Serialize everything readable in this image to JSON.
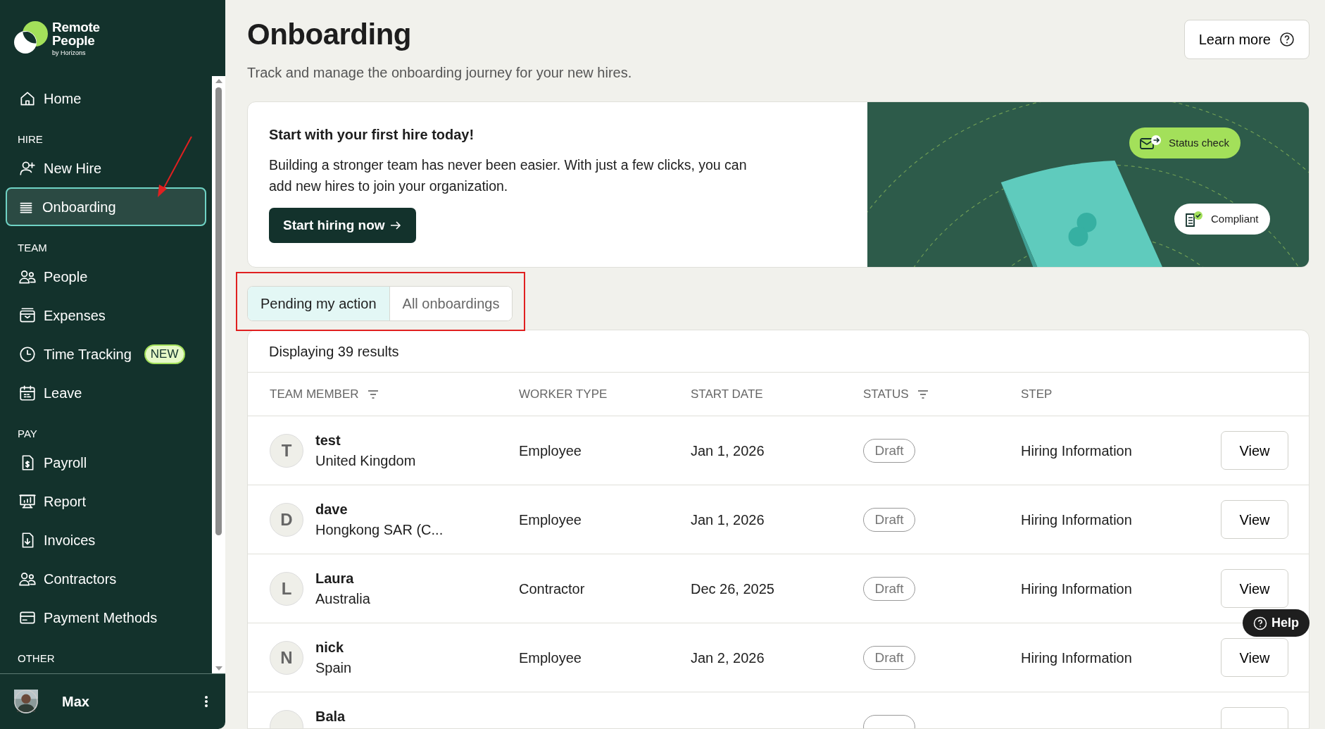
{
  "sidebar": {
    "logo": {
      "line1": "Remote",
      "line2": "People",
      "tagline": "by Horizons"
    },
    "sections": [
      {
        "items": [
          {
            "label": "Home",
            "selected": false
          }
        ]
      },
      {
        "heading": "HIRE",
        "items": [
          {
            "label": "New Hire",
            "selected": false
          },
          {
            "label": "Onboarding",
            "selected": true
          }
        ]
      },
      {
        "heading": "TEAM",
        "items": [
          {
            "label": "People",
            "selected": false
          },
          {
            "label": "Expenses",
            "selected": false
          },
          {
            "label": "Time Tracking",
            "selected": false,
            "badge": "NEW"
          },
          {
            "label": "Leave",
            "selected": false
          }
        ]
      },
      {
        "heading": "PAY",
        "items": [
          {
            "label": "Payroll",
            "selected": false
          },
          {
            "label": "Report",
            "selected": false
          },
          {
            "label": "Invoices",
            "selected": false
          },
          {
            "label": "Contractors",
            "selected": false
          },
          {
            "label": "Payment Methods",
            "selected": false
          }
        ]
      },
      {
        "heading": "OTHER"
      }
    ],
    "user": {
      "name": "Max"
    }
  },
  "header": {
    "title": "Onboarding",
    "subtitle": "Track and manage the onboarding journey for your new hires.",
    "learn_more": "Learn more"
  },
  "banner": {
    "title": "Start with your first hire today!",
    "text": "Building a stronger team has never been easier. With just a few clicks, you can add new hires to join your organization.",
    "button": "Start hiring now",
    "pills": [
      {
        "label": "Status check",
        "kind": "status"
      },
      {
        "label": "Compliant",
        "kind": "compliant"
      }
    ]
  },
  "tabs": [
    {
      "label": "Pending my action",
      "selected": true
    },
    {
      "label": "All onboardings",
      "selected": false
    }
  ],
  "table": {
    "summary": "Displaying 39 results",
    "columns": [
      {
        "label": "TEAM MEMBER",
        "filter": true
      },
      {
        "label": "WORKER TYPE",
        "filter": false
      },
      {
        "label": "START DATE",
        "filter": false
      },
      {
        "label": "STATUS",
        "filter": true
      },
      {
        "label": "STEP",
        "filter": false
      }
    ],
    "rows": [
      {
        "initial": "T",
        "name": "test",
        "country": "United Kingdom",
        "worker_type": "Employee",
        "start_date": "Jan 1, 2026",
        "status": "Draft",
        "step": "Hiring Information",
        "action": "View"
      },
      {
        "initial": "D",
        "name": "dave",
        "country": "Hongkong SAR (C...",
        "worker_type": "Employee",
        "start_date": "Jan 1, 2026",
        "status": "Draft",
        "step": "Hiring Information",
        "action": "View"
      },
      {
        "initial": "L",
        "name": "Laura",
        "country": "Australia",
        "worker_type": "Contractor",
        "start_date": "Dec 26, 2025",
        "status": "Draft",
        "step": "Hiring Information",
        "action": "View"
      },
      {
        "initial": "N",
        "name": "nick",
        "country": "Spain",
        "worker_type": "Employee",
        "start_date": "Jan 2, 2026",
        "status": "Draft",
        "step": "Hiring Information",
        "action": "View"
      },
      {
        "name": "Bala"
      }
    ]
  },
  "help": {
    "label": "Help"
  }
}
